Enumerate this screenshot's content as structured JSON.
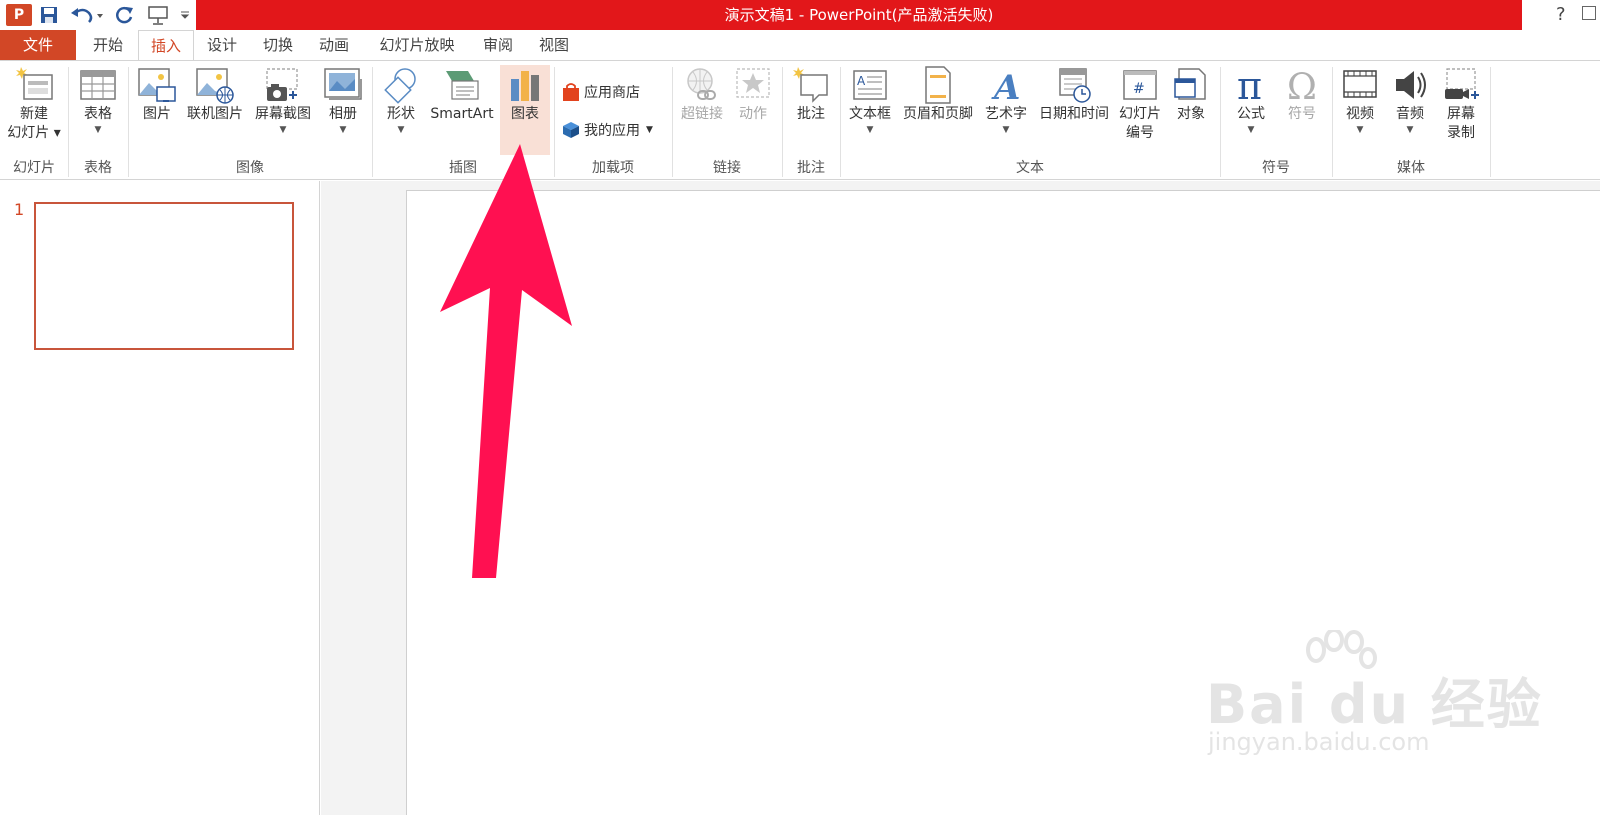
{
  "window": {
    "title": "演示文稿1 -  PowerPoint(产品激活失败)",
    "help": "?"
  },
  "qat": {
    "logo": "P"
  },
  "tabs": [
    "文件",
    "开始",
    "插入",
    "设计",
    "切换",
    "动画",
    "幻灯片放映",
    "审阅",
    "视图"
  ],
  "ribbon": {
    "groups": {
      "slides": "幻灯片",
      "table": "表格",
      "image": "图像",
      "illustrations": "插图",
      "addins": "加载项",
      "links": "链接",
      "comments": "批注",
      "text": "文本",
      "symbols": "符号",
      "media": "媒体"
    },
    "buttons": {
      "new_slide_1": "新建",
      "new_slide_2": "幻灯片",
      "table": "表格",
      "picture": "图片",
      "online_picture": "联机图片",
      "screenshot": "屏幕截图",
      "album": "相册",
      "shapes": "形状",
      "smartart": "SmartArt",
      "chart": "图表",
      "app_store": "应用商店",
      "my_apps": "我的应用",
      "hyperlink": "超链接",
      "action": "动作",
      "comment": "批注",
      "textbox": "文本框",
      "header_footer": "页眉和页脚",
      "wordart": "艺术字",
      "datetime": "日期和时间",
      "slide_number_1": "幻灯片",
      "slide_number_2": "编号",
      "object": "对象",
      "equation": "公式",
      "symbol": "符号",
      "video": "视频",
      "audio": "音频",
      "screen_rec_1": "屏幕",
      "screen_rec_2": "录制"
    }
  },
  "slides_panel": {
    "number": "1"
  },
  "watermark": {
    "main": "Bai du 经验",
    "sub": "jingyan.baidu.com"
  },
  "colors": {
    "accent": "#d24726",
    "title_bar": "#e2171a",
    "arrow": "#ff1051"
  }
}
